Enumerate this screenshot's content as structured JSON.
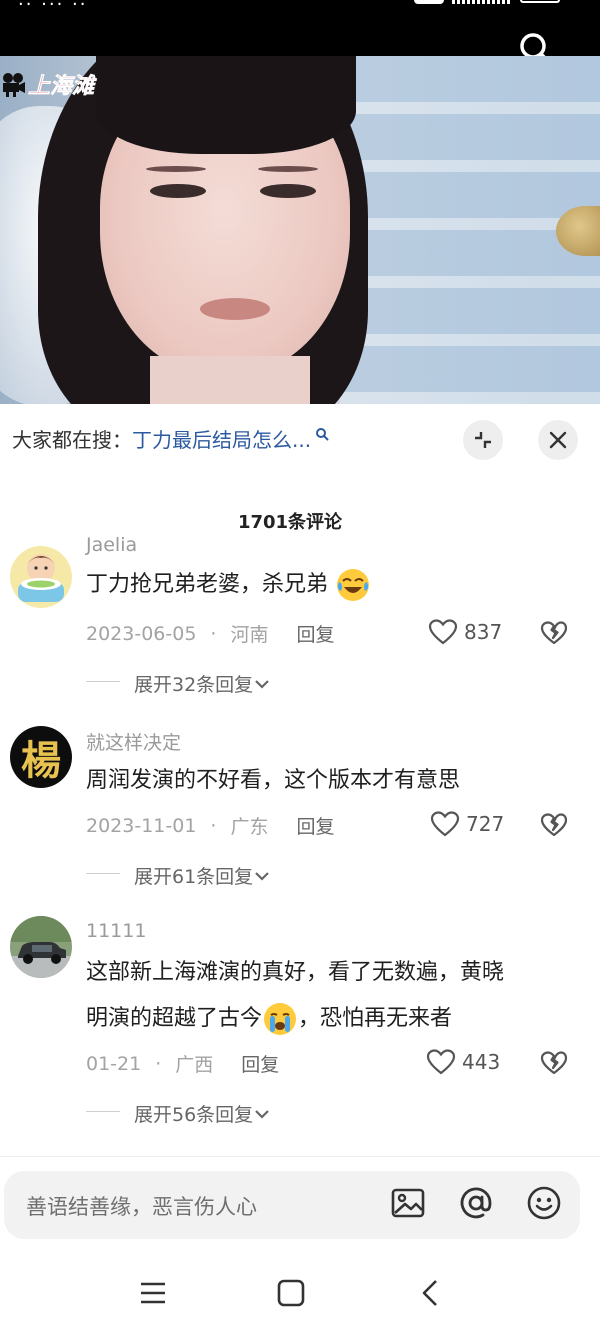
{
  "status_bar": {
    "left_text": "·· ··· ··"
  },
  "video": {
    "logo_text": "上海滩"
  },
  "hot_search": {
    "prefix": "大家都在搜：",
    "query": "丁力最后结局怎么..."
  },
  "comments_header": {
    "count_label": "1701条评论"
  },
  "comments": [
    {
      "username": "Jaelia",
      "text": "丁力抢兄弟老婆，杀兄弟",
      "emoji": "crying-laughing-emoji",
      "date": "2023-06-05",
      "location": "河南",
      "reply_label": "回复",
      "likes": "837",
      "expand_label": "展开32条回复"
    },
    {
      "username": "就这样决定",
      "avatar_char": "楊",
      "text": "周润发演的不好看，这个版本才有意思",
      "date": "2023-11-01",
      "location": "广东",
      "reply_label": "回复",
      "likes": "727",
      "expand_label": "展开61条回复"
    },
    {
      "username": "11111",
      "text_line1": "这部新上海滩演的真好，看了无数遍，黄晓",
      "text_line2a": "明演的超越了古今",
      "text_line2b": "，恐怕再无来者",
      "emoji": "crying-emoji",
      "date": "01-21",
      "location": "广西",
      "reply_label": "回复",
      "likes": "443",
      "expand_label": "展开56条回复"
    }
  ],
  "input": {
    "placeholder": "善语结善缘，恶言伤人心"
  },
  "colors": {
    "link_blue": "#2c5aa0",
    "logo_red": "#d9232b"
  }
}
